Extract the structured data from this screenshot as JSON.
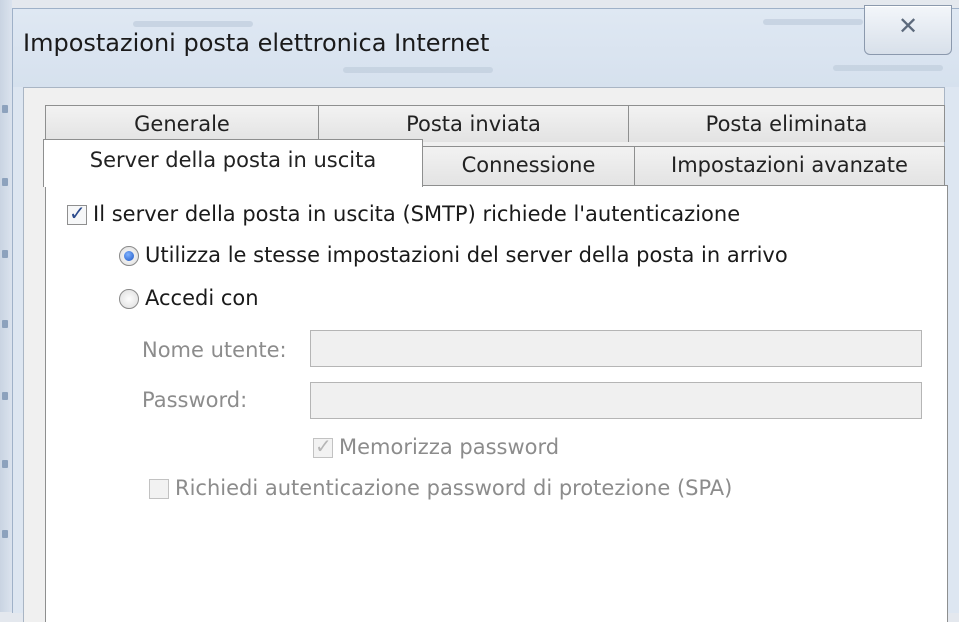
{
  "dialog": {
    "title": "Impostazioni posta elettronica Internet",
    "close_glyph": "✕"
  },
  "tabs": {
    "row1": [
      {
        "label": "Generale"
      },
      {
        "label": "Posta inviata"
      },
      {
        "label": "Posta eliminata"
      }
    ],
    "row2": [
      {
        "label": "Server della posta in uscita",
        "active": true
      },
      {
        "label": "Connessione"
      },
      {
        "label": "Impostazioni avanzate"
      }
    ]
  },
  "smtp_auth": {
    "label": "Il server della posta in uscita (SMTP) richiede l'autenticazione",
    "checked": true
  },
  "options": {
    "same_settings_label": "Utilizza le stesse impostazioni del server della posta in arrivo",
    "same_settings_selected": true,
    "login_with_label": "Accedi con",
    "login_with_selected": false
  },
  "credentials": {
    "username_label": "Nome utente:",
    "username_value": "",
    "password_label": "Password:",
    "password_value": "",
    "remember_password_label": "Memorizza password",
    "remember_password_checked": true,
    "spa_label": "Richiedi autenticazione password di protezione (SPA)",
    "spa_checked": false
  }
}
